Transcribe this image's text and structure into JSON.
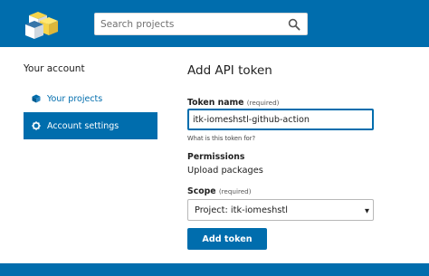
{
  "header": {
    "logo_icon": "pypi-logo-icon",
    "search": {
      "placeholder": "Search projects",
      "icon": "search-icon"
    }
  },
  "sidebar": {
    "title": "Your account",
    "items": [
      {
        "label": "Your projects",
        "icon": "cube-icon",
        "active": false
      },
      {
        "label": "Account settings",
        "icon": "gear-icon",
        "active": true
      }
    ]
  },
  "main": {
    "title": "Add API token",
    "token_name": {
      "label": "Token name",
      "required_note": "(required)",
      "value": "itk-iomeshstl-github-action",
      "help": "What is this token for?"
    },
    "permissions": {
      "label": "Permissions",
      "value": "Upload packages"
    },
    "scope": {
      "label": "Scope",
      "required_note": "(required)",
      "selected": "Project: itk-iomeshstl"
    },
    "submit_label": "Add token"
  },
  "colors": {
    "brand": "#006dad",
    "text": "#222222",
    "background": "#ffffff"
  }
}
